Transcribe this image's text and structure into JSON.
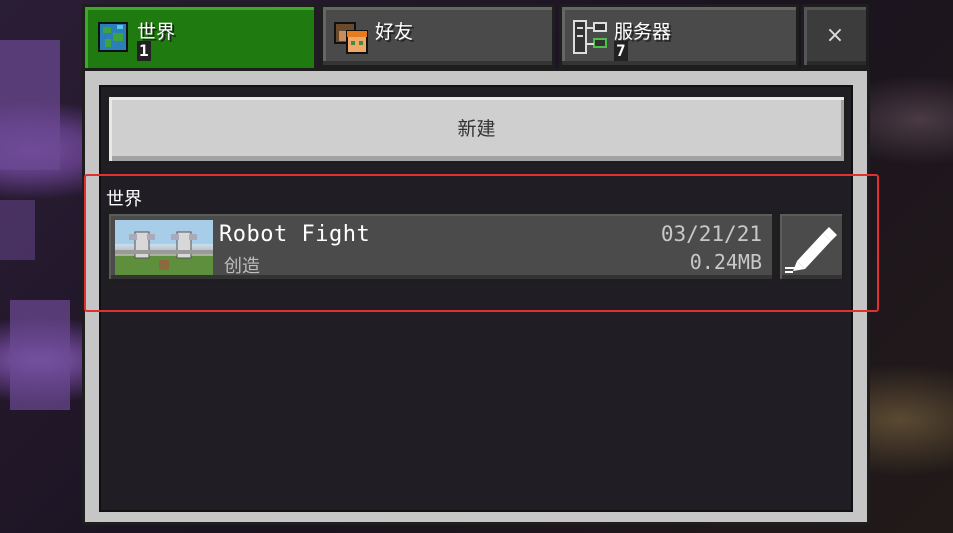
{
  "tabs": [
    {
      "label": "世界",
      "count": "1",
      "icon": "world-globe-icon",
      "active": true
    },
    {
      "label": "好友",
      "count": "",
      "icon": "friends-icon",
      "active": false
    },
    {
      "label": "服务器",
      "count": "7",
      "icon": "server-icon",
      "active": false
    }
  ],
  "close_label": "×",
  "new_button_label": "新建",
  "section_label": "世界",
  "world": {
    "name": "Robot Fight",
    "mode": "创造",
    "date": "03/21/21",
    "size": "0.24MB"
  },
  "colors": {
    "active_tab": "#1f7a10",
    "highlight": "#e0302f"
  }
}
